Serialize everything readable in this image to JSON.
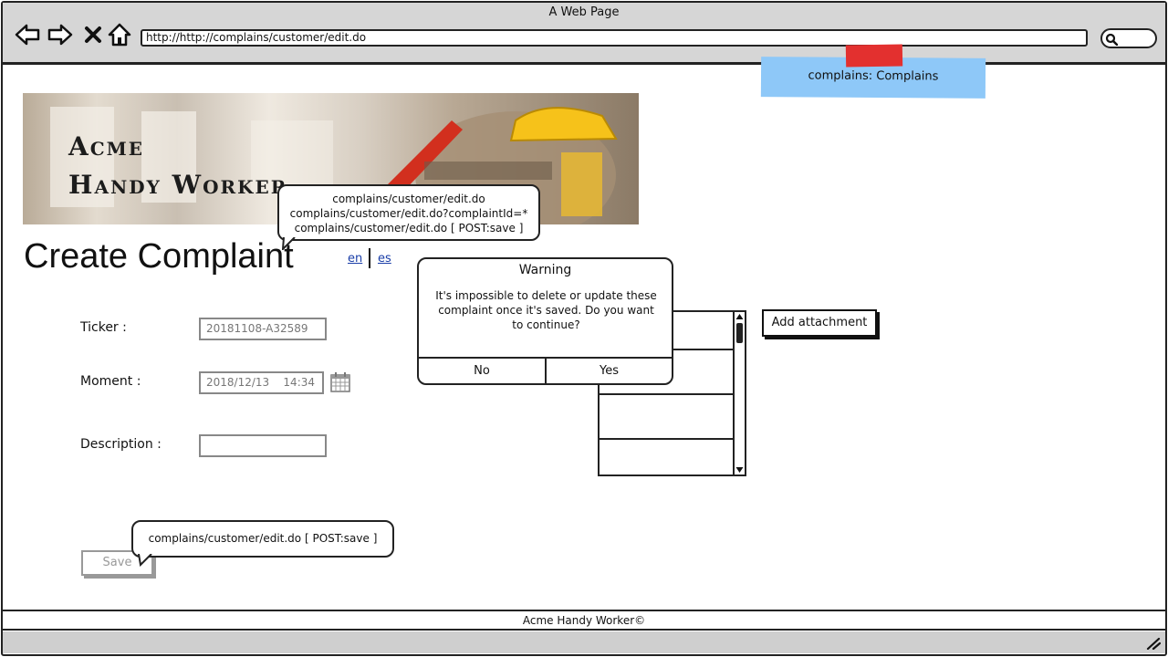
{
  "browser": {
    "window_title": "A Web Page",
    "url": "http://http://complains/customer/edit.do"
  },
  "sticky_note": {
    "text": "complains: Complains",
    "color": "#8ec8f8"
  },
  "banner": {
    "logo_line1": "Acme",
    "logo_line2": "Handy Worker"
  },
  "header": {
    "title": "Create Complaint",
    "lang_en": "en",
    "lang_es": "es"
  },
  "form": {
    "ticker_label": "Ticker :",
    "ticker_value": "20181108-A32589",
    "moment_label": "Moment :",
    "moment_value": "2018/12/13    14:34",
    "description_label": "Description :",
    "description_value": "",
    "save_label": "Save"
  },
  "attachments": {
    "add_label": "Add attachment"
  },
  "callouts": {
    "top_line1": "complains/customer/edit.do",
    "top_line2": "complains/customer/edit.do?complaintId=*",
    "top_line3": "complains/customer/edit.do [ POST:save ]",
    "save": "complains/customer/edit.do [ POST:save ]"
  },
  "dialog": {
    "title": "Warning",
    "message": "It's impossible to delete or update these complaint once it's saved. Do you want to continue?",
    "no_label": "No",
    "yes_label": "Yes"
  },
  "footer": {
    "text": "Acme Handy Worker©"
  },
  "icons": [
    "back-icon",
    "forward-icon",
    "close-icon",
    "home-icon",
    "search-icon",
    "calendar-icon",
    "resize-icon"
  ]
}
